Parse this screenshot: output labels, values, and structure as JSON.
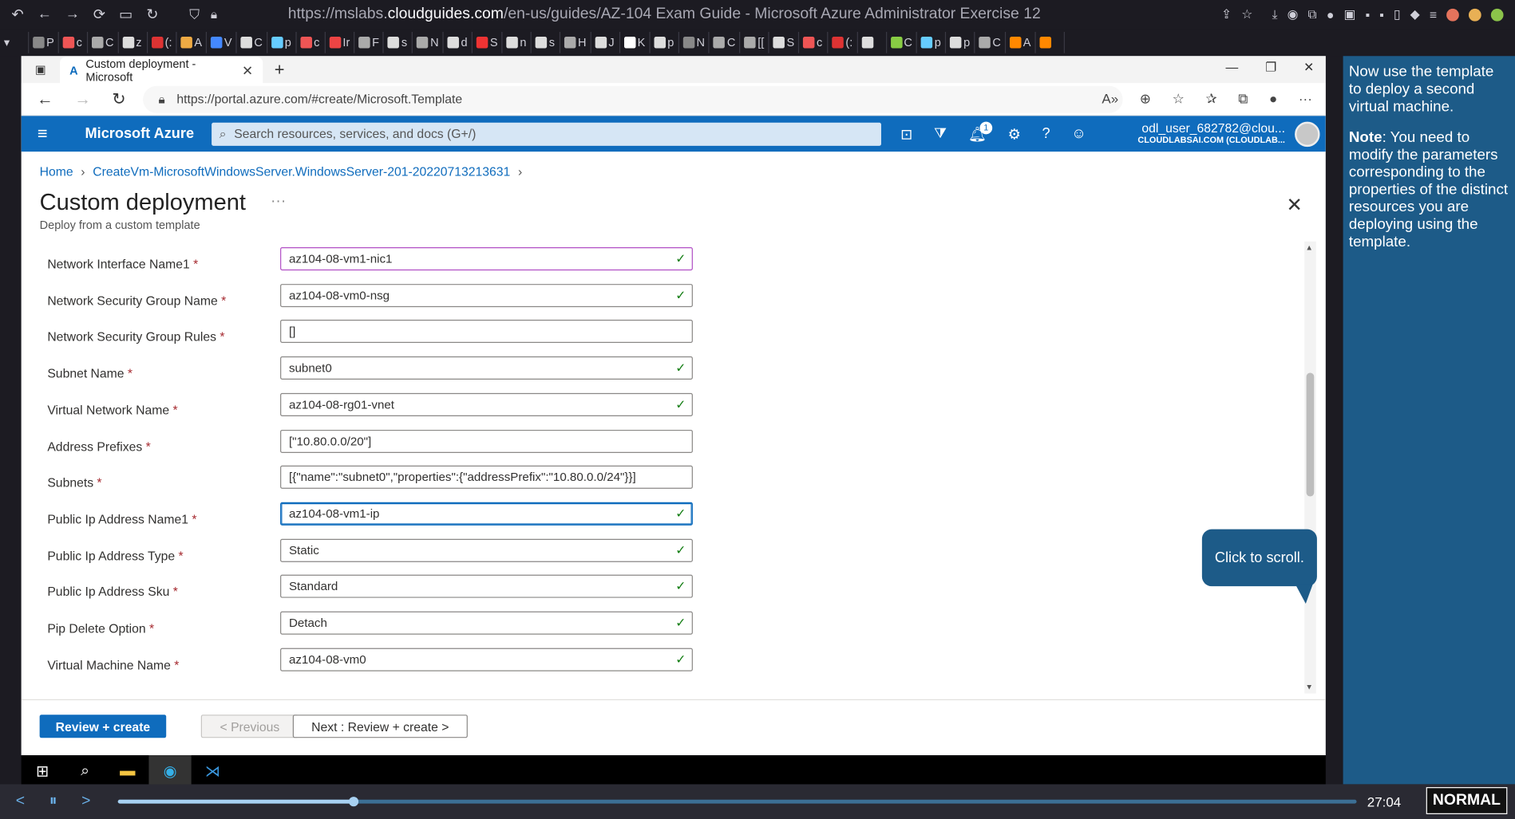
{
  "firefox": {
    "url_prefix": "https://mslabs.",
    "url_domain": "cloudguides.com",
    "url_path": "/en-us/guides/AZ-104 Exam Guide - Microsoft Azure Administrator Exercise 12",
    "tabs": [
      "P",
      "c",
      "C",
      "z",
      "(:",
      "A",
      "V",
      "C",
      "p",
      "c",
      "Ir",
      "F",
      "s",
      "N",
      "d",
      "S",
      "n",
      "s",
      "H",
      "J",
      "K",
      "p",
      "N",
      "C",
      "[[",
      "S",
      "c",
      "(:",
      "",
      "C",
      "p",
      "p",
      "C",
      "A",
      ""
    ]
  },
  "edge": {
    "tab_title": "Custom deployment - Microsoft",
    "address": "https://portal.azure.com/#create/Microsoft.Template"
  },
  "azure": {
    "brand": "Microsoft Azure",
    "search_placeholder": "Search resources, services, and docs (G+/)",
    "notification_count": "1",
    "user_email": "odl_user_682782@clou...",
    "user_tenant": "CLOUDLABSAI.COM (CLOUDLAB..."
  },
  "breadcrumb": {
    "home": "Home",
    "item": "CreateVm-MicrosoftWindowsServer.WindowsServer-201-20220713213631"
  },
  "page": {
    "title": "Custom deployment",
    "subtitle": "Deploy from a custom template",
    "ellipsis": "···"
  },
  "fields": [
    {
      "label": "Network Interface Name1",
      "value": "az104-08-vm1-nic1",
      "valid": true
    },
    {
      "label": "Network Security Group Name",
      "value": "az104-08-vm0-nsg",
      "valid": true
    },
    {
      "label": "Network Security Group Rules",
      "value": "[]",
      "valid": false
    },
    {
      "label": "Subnet Name",
      "value": "subnet0",
      "valid": true
    },
    {
      "label": "Virtual Network Name",
      "value": "az104-08-rg01-vnet",
      "valid": true
    },
    {
      "label": "Address Prefixes",
      "value": "[\"10.80.0.0/20\"]",
      "valid": false
    },
    {
      "label": "Subnets",
      "value": "[{\"name\":\"subnet0\",\"properties\":{\"addressPrefix\":\"10.80.0.0/24\"}}]",
      "valid": false
    },
    {
      "label": "Public Ip Address Name1",
      "value": "az104-08-vm1-ip",
      "valid": true
    },
    {
      "label": "Public Ip Address Type",
      "value": "Static",
      "valid": true
    },
    {
      "label": "Public Ip Address Sku",
      "value": "Standard",
      "valid": true
    },
    {
      "label": "Pip Delete Option",
      "value": "Detach",
      "valid": true
    },
    {
      "label": "Virtual Machine Name",
      "value": "az104-08-vm0",
      "valid": true
    }
  ],
  "buttons": {
    "review_create": "Review + create",
    "previous": "< Previous",
    "next": "Next : Review + create >"
  },
  "tooltip": "Click to scroll.",
  "instructions": {
    "p1": "Now use the template to deploy a second virtual machine.",
    "note_label": "Note",
    "note_text": ": You need to modify the parameters corresponding to the properties of the distinct resources you are deploying using the template."
  },
  "player": {
    "time": "27:04",
    "mode": "NORMAL",
    "progress": 0.19
  },
  "colors": {
    "azure_blue": "#0f6cbd",
    "guide_panel": "#1d5b88",
    "valid_check": "#107c10"
  }
}
